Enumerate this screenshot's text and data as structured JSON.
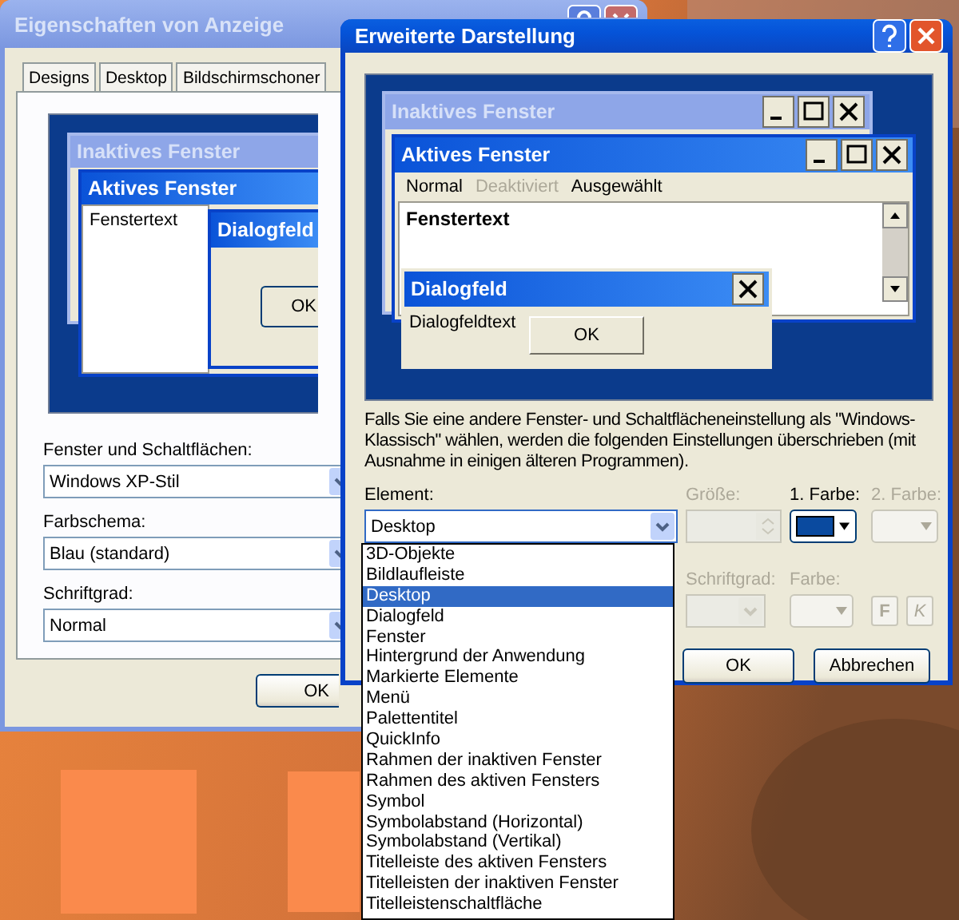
{
  "back_window": {
    "title": "Eigenschaften von Anzeige",
    "tabs": [
      {
        "label": "Designs",
        "selected": false
      },
      {
        "label": "Desktop",
        "selected": false
      },
      {
        "label": "Bildschirmschoner",
        "selected": false
      }
    ],
    "preview": {
      "inactive_title": "Inaktives Fenster",
      "active_title": "Aktives Fenster",
      "window_text": "Fenstertext",
      "dialog_title": "Dialogfeld",
      "dialog_button": "OK"
    },
    "fields": [
      {
        "label": "Fenster und Schaltflächen:",
        "value": "Windows XP-Stil"
      },
      {
        "label": "Farbschema:",
        "value": "Blau (standard)"
      },
      {
        "label": "Schriftgrad:",
        "value": "Normal"
      }
    ],
    "buttons": [
      "OK"
    ]
  },
  "front_window": {
    "title": "Erweiterte Darstellung",
    "preview": {
      "inactive_title": "Inaktives Fenster",
      "active_title": "Aktives Fenster",
      "menu": [
        {
          "label": "Normal",
          "disabled": false
        },
        {
          "label": "Deaktiviert",
          "disabled": true
        },
        {
          "label": "Ausgewählt",
          "disabled": false
        }
      ],
      "window_text": "Fenstertext",
      "dialog_title": "Dialogfeld",
      "dialog_text": "Dialogfeldtext",
      "dialog_button": "OK"
    },
    "note": "Falls Sie eine andere Fenster- und Schaltflächeneinstellung als \"Windows-Klassisch\" wählen, werden die folgenden Einstellungen überschrieben (mit Ausnahme in einigen älteren Programmen).",
    "element": {
      "label": "Element:",
      "value": "Desktop",
      "expanded": true,
      "options": [
        {
          "label": "3D-Objekte",
          "selected": false
        },
        {
          "label": "Bildlaufleiste",
          "selected": false
        },
        {
          "label": "Desktop",
          "selected": true
        },
        {
          "label": "Dialogfeld",
          "selected": false
        },
        {
          "label": "Fenster",
          "selected": false
        },
        {
          "label": "Hintergrund der Anwendung",
          "selected": false
        },
        {
          "label": "Markierte Elemente",
          "selected": false
        },
        {
          "label": "Menü",
          "selected": false
        },
        {
          "label": "Palettentitel",
          "selected": false
        },
        {
          "label": "QuickInfo",
          "selected": false
        },
        {
          "label": "Rahmen der inaktiven Fenster",
          "selected": false
        },
        {
          "label": "Rahmen des aktiven Fensters",
          "selected": false
        },
        {
          "label": "Symbol",
          "selected": false
        },
        {
          "label": "Symbolabstand (Horizontal)",
          "selected": false
        },
        {
          "label": "Symbolabstand (Vertikal)",
          "selected": false
        },
        {
          "label": "Titelleiste des aktiven Fensters",
          "selected": false
        },
        {
          "label": "Titelleisten der inaktiven Fenster",
          "selected": false
        },
        {
          "label": "Titelleistenschaltfläche",
          "selected": false
        }
      ]
    },
    "size": {
      "label": "Größe:",
      "disabled": true
    },
    "color1": {
      "label": "1. Farbe:",
      "color": "#0a4a9f"
    },
    "color2": {
      "label": "2. Farbe:",
      "disabled": true
    },
    "font_size": {
      "label": "Schriftgrad:",
      "disabled": true
    },
    "font_color": {
      "label": "Farbe:",
      "disabled": true
    },
    "bold": {
      "label": "F",
      "disabled": true
    },
    "italic": {
      "label": "K",
      "disabled": true
    },
    "buttons": [
      "OK",
      "Abbrechen"
    ]
  }
}
